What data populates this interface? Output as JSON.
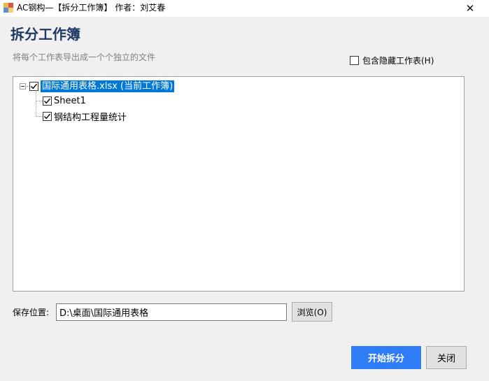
{
  "window": {
    "title": "AC钢构—【拆分工作簿】 作者：刘艾春",
    "close_glyph": "✕"
  },
  "header": {
    "title": "拆分工作簿",
    "subtitle": "将每个工作表导出成一个个独立的文件"
  },
  "options": {
    "include_hidden_label": "包含隐藏工作表(H)",
    "include_hidden_checked": false
  },
  "tree": {
    "root": {
      "label": "国际通用表格.xlsx (当前工作簿)",
      "checked": true,
      "selected": true,
      "expanded": true
    },
    "children": [
      {
        "label": "Sheet1",
        "checked": true
      },
      {
        "label": "钢结构工程量统计",
        "checked": true
      }
    ]
  },
  "save": {
    "label": "保存位置:",
    "path_value": "D:\\桌面\\国际通用表格",
    "browse_label": "浏览(O)"
  },
  "footer": {
    "start_label": "开始拆分",
    "close_label": "关闭"
  },
  "colors": {
    "heading": "#1f3864",
    "selection": "#0078d7",
    "primary_button": "#2e7cf6"
  }
}
